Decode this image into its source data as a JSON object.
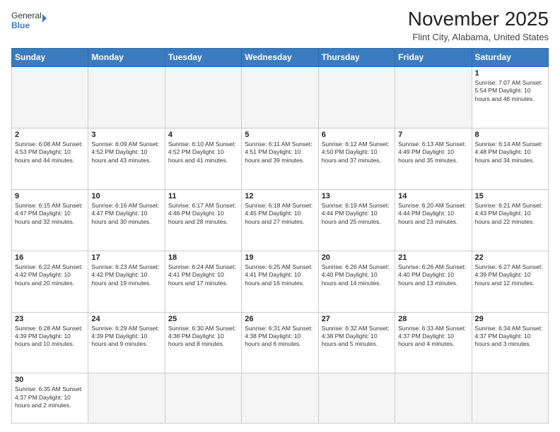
{
  "logo": {
    "text_general": "General",
    "text_blue": "Blue"
  },
  "title": {
    "month_year": "November 2025",
    "location": "Flint City, Alabama, United States"
  },
  "weekdays": [
    "Sunday",
    "Monday",
    "Tuesday",
    "Wednesday",
    "Thursday",
    "Friday",
    "Saturday"
  ],
  "weeks": [
    [
      {
        "day": "",
        "info": ""
      },
      {
        "day": "",
        "info": ""
      },
      {
        "day": "",
        "info": ""
      },
      {
        "day": "",
        "info": ""
      },
      {
        "day": "",
        "info": ""
      },
      {
        "day": "",
        "info": ""
      },
      {
        "day": "1",
        "info": "Sunrise: 7:07 AM\nSunset: 5:54 PM\nDaylight: 10 hours and 46 minutes."
      }
    ],
    [
      {
        "day": "2",
        "info": "Sunrise: 6:08 AM\nSunset: 4:53 PM\nDaylight: 10 hours and 44 minutes."
      },
      {
        "day": "3",
        "info": "Sunrise: 6:09 AM\nSunset: 4:52 PM\nDaylight: 10 hours and 43 minutes."
      },
      {
        "day": "4",
        "info": "Sunrise: 6:10 AM\nSunset: 4:52 PM\nDaylight: 10 hours and 41 minutes."
      },
      {
        "day": "5",
        "info": "Sunrise: 6:11 AM\nSunset: 4:51 PM\nDaylight: 10 hours and 39 minutes."
      },
      {
        "day": "6",
        "info": "Sunrise: 6:12 AM\nSunset: 4:50 PM\nDaylight: 10 hours and 37 minutes."
      },
      {
        "day": "7",
        "info": "Sunrise: 6:13 AM\nSunset: 4:49 PM\nDaylight: 10 hours and 35 minutes."
      },
      {
        "day": "8",
        "info": "Sunrise: 6:14 AM\nSunset: 4:48 PM\nDaylight: 10 hours and 34 minutes."
      }
    ],
    [
      {
        "day": "9",
        "info": "Sunrise: 6:15 AM\nSunset: 4:47 PM\nDaylight: 10 hours and 32 minutes."
      },
      {
        "day": "10",
        "info": "Sunrise: 6:16 AM\nSunset: 4:47 PM\nDaylight: 10 hours and 30 minutes."
      },
      {
        "day": "11",
        "info": "Sunrise: 6:17 AM\nSunset: 4:46 PM\nDaylight: 10 hours and 28 minutes."
      },
      {
        "day": "12",
        "info": "Sunrise: 6:18 AM\nSunset: 4:45 PM\nDaylight: 10 hours and 27 minutes."
      },
      {
        "day": "13",
        "info": "Sunrise: 6:19 AM\nSunset: 4:44 PM\nDaylight: 10 hours and 25 minutes."
      },
      {
        "day": "14",
        "info": "Sunrise: 6:20 AM\nSunset: 4:44 PM\nDaylight: 10 hours and 23 minutes."
      },
      {
        "day": "15",
        "info": "Sunrise: 6:21 AM\nSunset: 4:43 PM\nDaylight: 10 hours and 22 minutes."
      }
    ],
    [
      {
        "day": "16",
        "info": "Sunrise: 6:22 AM\nSunset: 4:42 PM\nDaylight: 10 hours and 20 minutes."
      },
      {
        "day": "17",
        "info": "Sunrise: 6:23 AM\nSunset: 4:42 PM\nDaylight: 10 hours and 19 minutes."
      },
      {
        "day": "18",
        "info": "Sunrise: 6:24 AM\nSunset: 4:41 PM\nDaylight: 10 hours and 17 minutes."
      },
      {
        "day": "19",
        "info": "Sunrise: 6:25 AM\nSunset: 4:41 PM\nDaylight: 10 hours and 16 minutes."
      },
      {
        "day": "20",
        "info": "Sunrise: 6:26 AM\nSunset: 4:40 PM\nDaylight: 10 hours and 14 minutes."
      },
      {
        "day": "21",
        "info": "Sunrise: 6:26 AM\nSunset: 4:40 PM\nDaylight: 10 hours and 13 minutes."
      },
      {
        "day": "22",
        "info": "Sunrise: 6:27 AM\nSunset: 4:39 PM\nDaylight: 10 hours and 12 minutes."
      }
    ],
    [
      {
        "day": "23",
        "info": "Sunrise: 6:28 AM\nSunset: 4:39 PM\nDaylight: 10 hours and 10 minutes."
      },
      {
        "day": "24",
        "info": "Sunrise: 6:29 AM\nSunset: 4:39 PM\nDaylight: 10 hours and 9 minutes."
      },
      {
        "day": "25",
        "info": "Sunrise: 6:30 AM\nSunset: 4:38 PM\nDaylight: 10 hours and 8 minutes."
      },
      {
        "day": "26",
        "info": "Sunrise: 6:31 AM\nSunset: 4:38 PM\nDaylight: 10 hours and 6 minutes."
      },
      {
        "day": "27",
        "info": "Sunrise: 6:32 AM\nSunset: 4:38 PM\nDaylight: 10 hours and 5 minutes."
      },
      {
        "day": "28",
        "info": "Sunrise: 6:33 AM\nSunset: 4:37 PM\nDaylight: 10 hours and 4 minutes."
      },
      {
        "day": "29",
        "info": "Sunrise: 6:34 AM\nSunset: 4:37 PM\nDaylight: 10 hours and 3 minutes."
      }
    ],
    [
      {
        "day": "30",
        "info": "Sunrise: 6:35 AM\nSunset: 4:37 PM\nDaylight: 10 hours and 2 minutes."
      },
      {
        "day": "",
        "info": ""
      },
      {
        "day": "",
        "info": ""
      },
      {
        "day": "",
        "info": ""
      },
      {
        "day": "",
        "info": ""
      },
      {
        "day": "",
        "info": ""
      },
      {
        "day": "",
        "info": ""
      }
    ]
  ]
}
